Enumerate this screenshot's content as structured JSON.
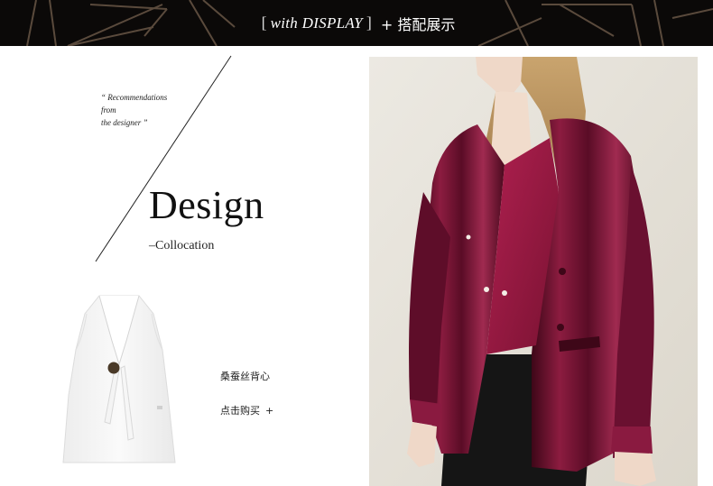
{
  "banner": {
    "bracket_open": "[",
    "title_en": "with DISPLAY",
    "bracket_close": "]",
    "title_cn": "+ 搭配展示"
  },
  "intro": {
    "rec_line1": "“ Recommendations",
    "rec_line2": "from",
    "rec_line3": "the designer ”"
  },
  "heading": {
    "title": "Design",
    "subtitle": "–Collocation"
  },
  "product": {
    "name": "桑蚕丝背心",
    "buy_label": "点击购买",
    "buy_plus": "+"
  },
  "colors": {
    "banner_bg": "#0b0908",
    "deco_line": "#5a4a3c",
    "velvet": "#6e1230",
    "photo_bg": "#e6e2d9"
  },
  "icons": {
    "vest": "white-silk-vest-image",
    "model": "model-photo"
  }
}
